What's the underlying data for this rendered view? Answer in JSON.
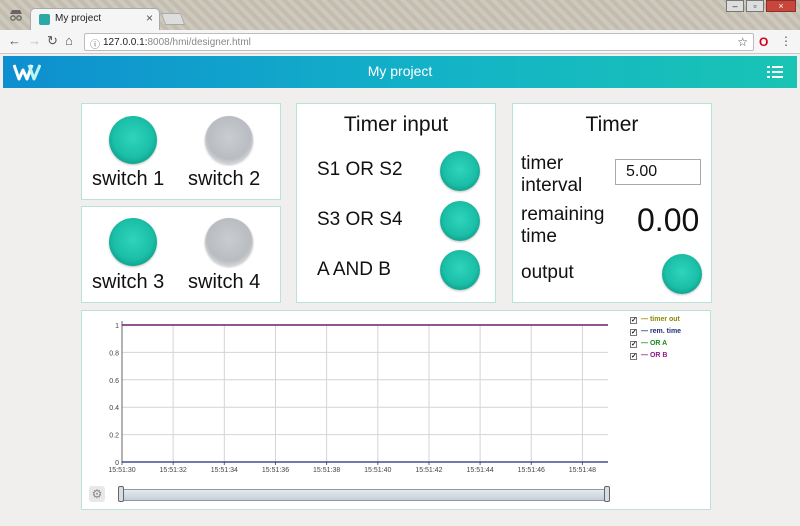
{
  "browser": {
    "tab_title": "My project",
    "tab_close": "×",
    "url_host": "127.0.0.1:",
    "url_rest": "8008/hmi/designer.html",
    "info_icon": "info-icon",
    "back": "←",
    "forward": "→",
    "reload": "↻",
    "home": "⌂",
    "star": "☆",
    "opera": "O",
    "menu": "⋮",
    "win_min": "–",
    "win_max": "▫",
    "win_close": "×"
  },
  "app": {
    "title": "My project",
    "brand_color": "#0e8fd0",
    "accent_color": "#19c4b4"
  },
  "switches": [
    {
      "label": "switch 1",
      "state": "on"
    },
    {
      "label": "switch 2",
      "state": "off"
    },
    {
      "label": "switch 3",
      "state": "on"
    },
    {
      "label": "switch 4",
      "state": "off"
    }
  ],
  "timer_input_panel": {
    "title": "Timer input",
    "rows": [
      {
        "label": "S1 OR S2",
        "state": "on"
      },
      {
        "label": "S3 OR S4",
        "state": "on"
      },
      {
        "label": "A AND B",
        "state": "on"
      }
    ]
  },
  "timer_panel": {
    "title": "Timer",
    "interval_label_1": "timer",
    "interval_label_2": "interval",
    "interval_value": "5.00",
    "remaining_label_1": "remaining",
    "remaining_label_2": "time",
    "remaining_value": "0.00",
    "output_label": "output",
    "output_state": "on"
  },
  "chart_data": {
    "type": "line",
    "title": "",
    "xlabel": "",
    "ylabel": "",
    "ylim": [
      0,
      1
    ],
    "yticks": [
      "0",
      "0.2",
      "0.4",
      "0.6",
      "0.8",
      "1"
    ],
    "xticks": [
      "15:51:30",
      "15:51:32",
      "15:51:34",
      "15:51:36",
      "15:51:38",
      "15:51:40",
      "15:51:42",
      "15:51:44",
      "15:51:46",
      "15:51:48"
    ],
    "x": [
      "15:51:30",
      "15:51:49"
    ],
    "series": [
      {
        "name": "timer out",
        "color": "#8a8a00",
        "values": [
          1,
          1
        ],
        "checked": true
      },
      {
        "name": "rem. time",
        "color": "#1f2f7a",
        "values": [
          0,
          0
        ],
        "checked": true
      },
      {
        "name": "OR A",
        "color": "#1a8a1a",
        "values": [
          1,
          1
        ],
        "checked": true
      },
      {
        "name": "OR B",
        "color": "#8a1a8a",
        "values": [
          1,
          1
        ],
        "checked": true
      }
    ],
    "grid": true,
    "legend": "top-right"
  }
}
